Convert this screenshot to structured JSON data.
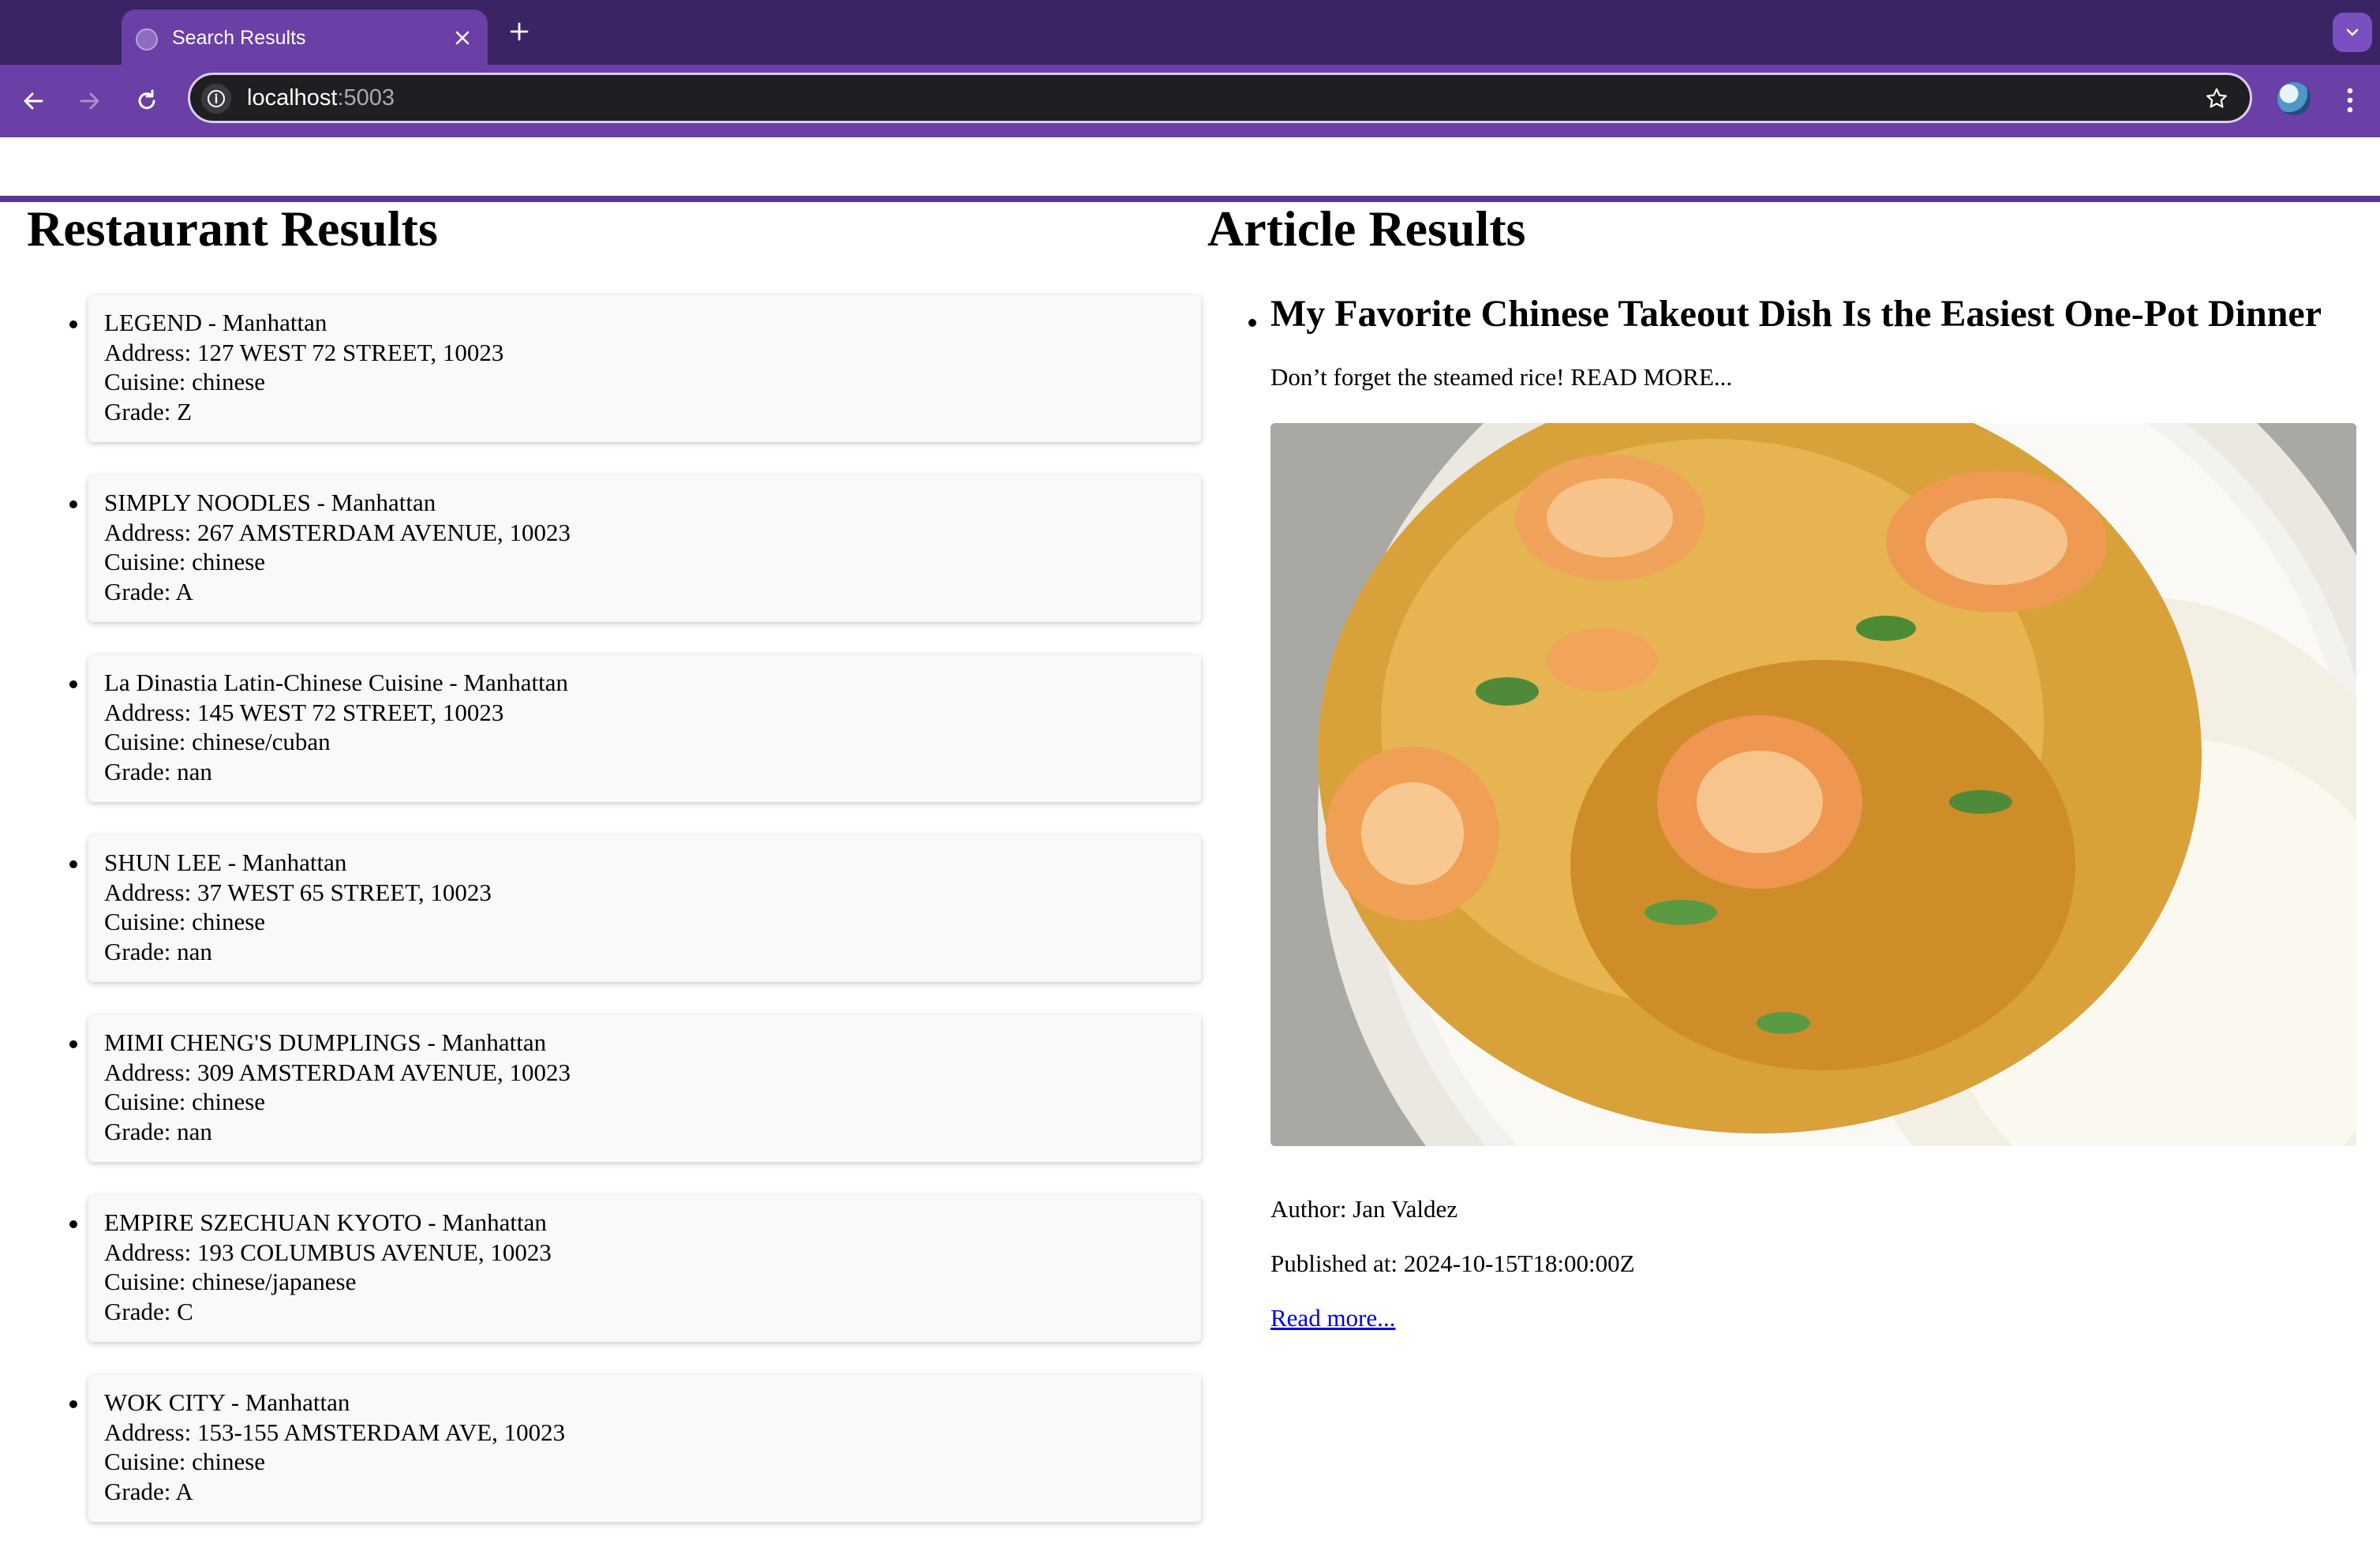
{
  "browser": {
    "tab_title": "Search Results",
    "url_host": "localhost",
    "url_port": ":5003"
  },
  "restaurants": {
    "heading": "Restaurant Results",
    "items": [
      {
        "name": "LEGEND - Manhattan",
        "address": "Address: 127 WEST 72 STREET, 10023",
        "cuisine": "Cuisine: chinese",
        "grade": "Grade: Z"
      },
      {
        "name": "SIMPLY NOODLES - Manhattan",
        "address": "Address: 267 AMSTERDAM AVENUE, 10023",
        "cuisine": "Cuisine: chinese",
        "grade": "Grade: A"
      },
      {
        "name": "La Dinastia Latin-Chinese Cuisine - Manhattan",
        "address": "Address: 145 WEST 72 STREET, 10023",
        "cuisine": "Cuisine: chinese/cuban",
        "grade": "Grade: nan"
      },
      {
        "name": "SHUN LEE - Manhattan",
        "address": "Address: 37 WEST 65 STREET, 10023",
        "cuisine": "Cuisine: chinese",
        "grade": "Grade: nan"
      },
      {
        "name": "MIMI CHENG'S DUMPLINGS - Manhattan",
        "address": "Address: 309 AMSTERDAM AVENUE, 10023",
        "cuisine": "Cuisine: chinese",
        "grade": "Grade: nan"
      },
      {
        "name": "EMPIRE SZECHUAN KYOTO - Manhattan",
        "address": "Address: 193 COLUMBUS AVENUE, 10023",
        "cuisine": "Cuisine: chinese/japanese",
        "grade": "Grade: C"
      },
      {
        "name": "WOK CITY - Manhattan",
        "address": "Address: 153-155 AMSTERDAM AVE, 10023",
        "cuisine": "Cuisine: chinese",
        "grade": "Grade: A"
      }
    ]
  },
  "articles": {
    "heading": "Article Results",
    "items": [
      {
        "title": "My Favorite Chinese Takeout Dish Is the Easiest One-Pot Dinner",
        "description": "Don’t forget the steamed rice! READ MORE...",
        "author": "Author: Jan Valdez",
        "published": "Published at: 2024-10-15T18:00:00Z",
        "link_label": "Read more..."
      }
    ]
  }
}
